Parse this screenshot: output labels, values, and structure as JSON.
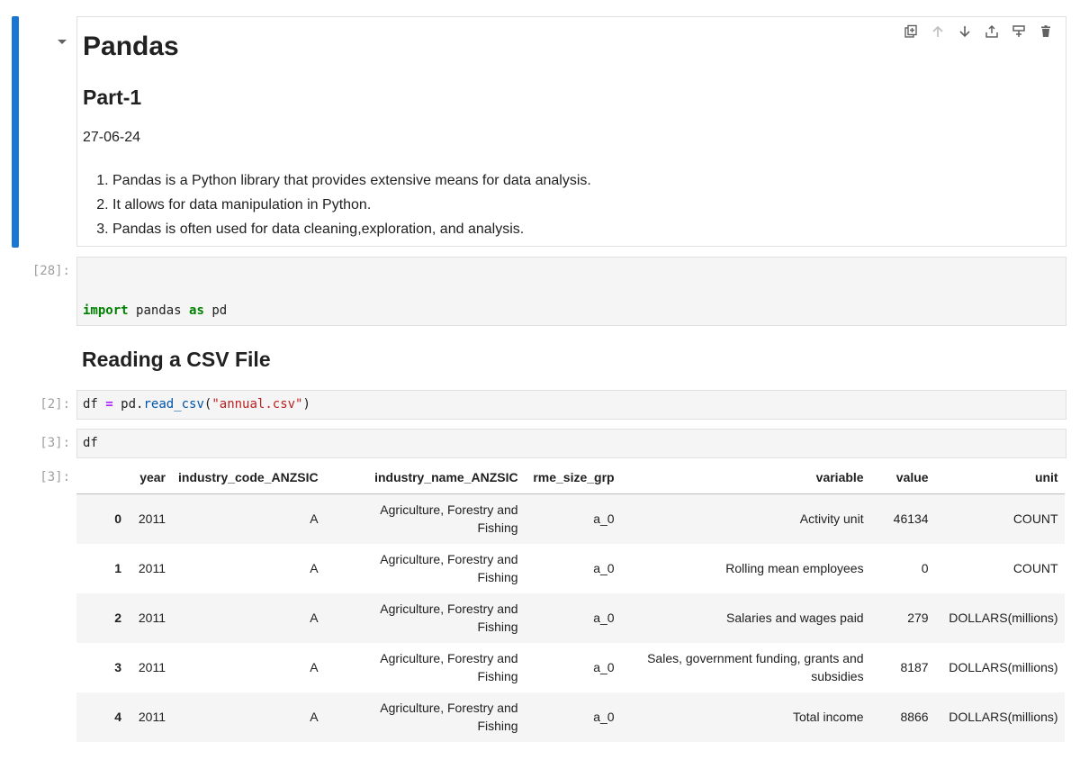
{
  "markdown": {
    "title": "Pandas",
    "subtitle": "Part-1",
    "date": "27-06-24",
    "list": [
      "Pandas is a Python library that provides extensive means for data analysis.",
      "It allows for data manipulation in Python.",
      "Pandas is often used for data cleaning,exploration, and analysis."
    ]
  },
  "toolbar_icons": [
    "duplicate-icon",
    "move-up-icon",
    "move-down-icon",
    "insert-above-icon",
    "insert-below-icon",
    "delete-icon"
  ],
  "cells": {
    "import": {
      "prompt": "[28]:",
      "kw1": "import",
      "mod": "pandas",
      "kw2": "as",
      "alias": "pd"
    },
    "heading": "Reading a CSV File",
    "read": {
      "prompt": "[2]:",
      "var": "df",
      "eq": "=",
      "obj": "pd.",
      "func": "read_csv",
      "lp": "(",
      "arg": "\"annual.csv\"",
      "rp": ")"
    },
    "df": {
      "prompt": "[3]:",
      "code": "df",
      "out_prompt": "[3]:"
    }
  },
  "table": {
    "columns": [
      "",
      "year",
      "industry_code_ANZSIC",
      "industry_name_ANZSIC",
      "rme_size_grp",
      "variable",
      "value",
      "unit"
    ],
    "rows": [
      {
        "idx": "0",
        "year": "2011",
        "code": "A",
        "name1": "Agriculture, Forestry and",
        "name2": "Fishing",
        "size": "a_0",
        "var1": "Activity unit",
        "var2": "",
        "value": "46134",
        "unit": "COUNT"
      },
      {
        "idx": "1",
        "year": "2011",
        "code": "A",
        "name1": "Agriculture, Forestry and",
        "name2": "Fishing",
        "size": "a_0",
        "var1": "Rolling mean employees",
        "var2": "",
        "value": "0",
        "unit": "COUNT"
      },
      {
        "idx": "2",
        "year": "2011",
        "code": "A",
        "name1": "Agriculture, Forestry and",
        "name2": "Fishing",
        "size": "a_0",
        "var1": "Salaries and wages paid",
        "var2": "",
        "value": "279",
        "unit": "DOLLARS(millions)"
      },
      {
        "idx": "3",
        "year": "2011",
        "code": "A",
        "name1": "Agriculture, Forestry and",
        "name2": "Fishing",
        "size": "a_0",
        "var1": "Sales, government funding, grants and",
        "var2": "subsidies",
        "value": "8187",
        "unit": "DOLLARS(millions)"
      },
      {
        "idx": "4",
        "year": "2011",
        "code": "A",
        "name1": "Agriculture, Forestry and",
        "name2": "Fishing",
        "size": "a_0",
        "var1": "Total income",
        "var2": "",
        "value": "8866",
        "unit": "DOLLARS(millions)"
      }
    ]
  }
}
